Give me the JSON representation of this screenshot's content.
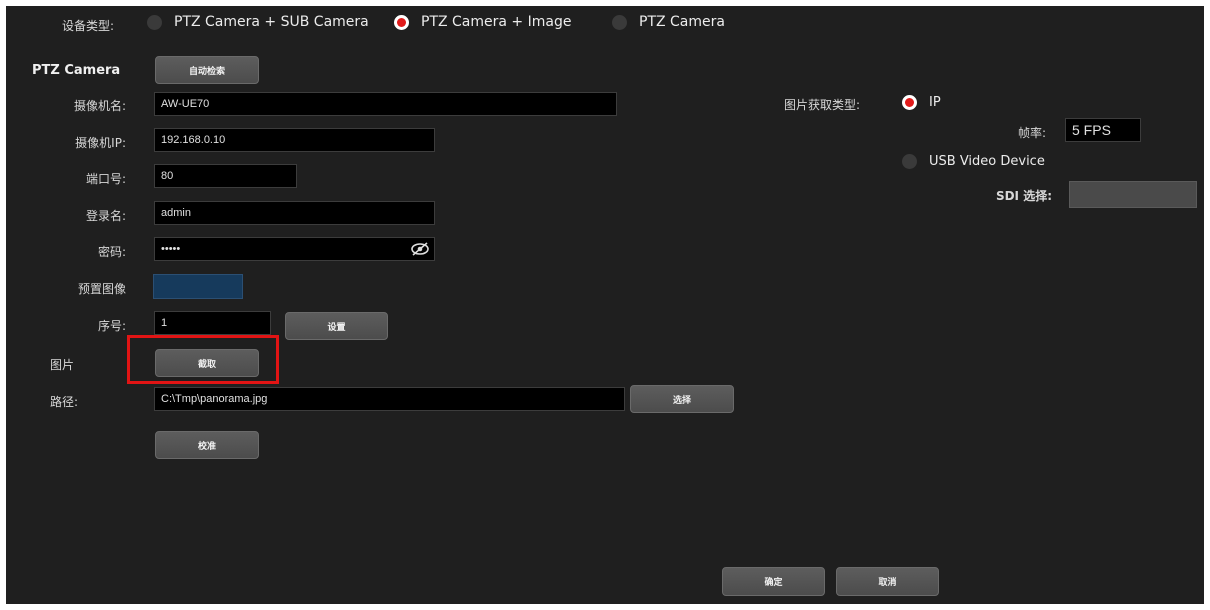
{
  "device_type": {
    "label": "设备类型:",
    "options": [
      {
        "label": "PTZ Camera + SUB Camera",
        "selected": false
      },
      {
        "label": "PTZ Camera + Image",
        "selected": true
      },
      {
        "label": "PTZ Camera",
        "selected": false
      }
    ]
  },
  "ptz": {
    "section_title": "PTZ Camera",
    "auto_search_button": "自动检索",
    "camera_name_label": "摄像机名:",
    "camera_name_value": "AW-UE70",
    "camera_ip_label": "摄像机IP:",
    "camera_ip_value": "192.168.0.10",
    "port_label": "端口号:",
    "port_value": "80",
    "login_label": "登录名:",
    "login_value": "admin",
    "password_label": "密码:",
    "password_value": "•••••",
    "preset_label": "预置图像",
    "serial_label": "序号:",
    "serial_value": "1",
    "set_button": "设置",
    "image_label": "图片",
    "capture_button": "截取",
    "path_label": "路径:",
    "path_value": "C:\\Tmp\\panorama.jpg",
    "select_button": "选择",
    "calibrate_button": "校准"
  },
  "image_source": {
    "label": "图片获取类型:",
    "options": [
      {
        "label": "IP",
        "selected": true
      },
      {
        "label": "USB Video Device",
        "selected": false
      }
    ],
    "fps_label": "帧率:",
    "fps_value": "5 FPS",
    "sdi_label": "SDI 选择:",
    "sdi_value": ""
  },
  "footer": {
    "ok_button": "确定",
    "cancel_button": "取消"
  },
  "colors": {
    "background": "#1f1f1f",
    "highlight": "#e11414",
    "radio_selected": "#e01a1a",
    "preset_swatch": "#163a5c"
  }
}
